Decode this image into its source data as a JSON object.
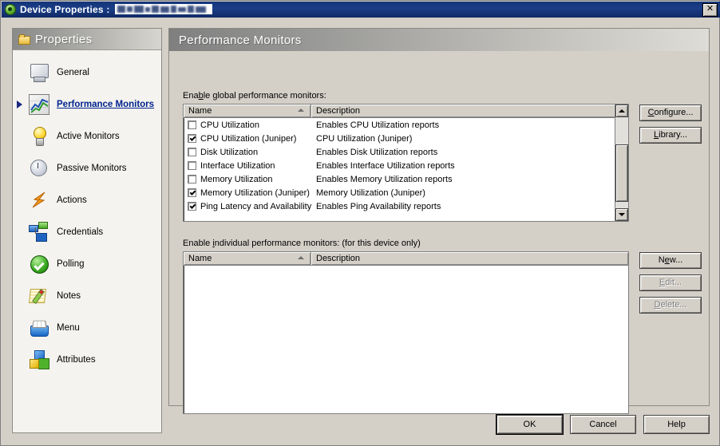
{
  "window": {
    "title": "Device Properties :",
    "device_name_redacted": true,
    "close_label": "✕",
    "icon": "green-device-icon"
  },
  "sidebar": {
    "header": "Properties",
    "header_icon": "folder-icon",
    "items": [
      {
        "label": "General",
        "icon": "computer-icon",
        "selected": false
      },
      {
        "label": "Performance Monitors",
        "icon": "chart-icon",
        "selected": true
      },
      {
        "label": "Active Monitors",
        "icon": "lightbulb-icon",
        "selected": false
      },
      {
        "label": "Passive Monitors",
        "icon": "clock-icon",
        "selected": false
      },
      {
        "label": "Actions",
        "icon": "lightning-arrow-icon",
        "selected": false
      },
      {
        "label": "Credentials",
        "icon": "network-nodes-icon",
        "selected": false
      },
      {
        "label": "Polling",
        "icon": "green-check-icon",
        "selected": false
      },
      {
        "label": "Notes",
        "icon": "notepad-pencil-icon",
        "selected": false
      },
      {
        "label": "Menu",
        "icon": "card-file-icon",
        "selected": false
      },
      {
        "label": "Attributes",
        "icon": "colored-blocks-icon",
        "selected": false
      }
    ]
  },
  "main": {
    "title": "Performance Monitors",
    "global_section": {
      "label_pre": "Ena",
      "label_key": "b",
      "label_post": "le global performance monitors:",
      "columns": [
        "Name",
        "Description"
      ],
      "sort_column": "Name",
      "sort_direction": "ascending",
      "rows": [
        {
          "checked": false,
          "name": "CPU Utilization",
          "description": "Enables CPU Utilization reports"
        },
        {
          "checked": true,
          "name": "CPU Utilization (Juniper)",
          "description": "CPU Utilization (Juniper)"
        },
        {
          "checked": false,
          "name": "Disk Utilization",
          "description": "Enables Disk Utilization reports"
        },
        {
          "checked": false,
          "name": "Interface Utilization",
          "description": "Enables Interface Utilization reports"
        },
        {
          "checked": false,
          "name": "Memory Utilization",
          "description": "Enables Memory Utilization reports"
        },
        {
          "checked": true,
          "name": "Memory Utilization (Juniper)",
          "description": "Memory Utilization (Juniper)"
        },
        {
          "checked": true,
          "name": "Ping Latency and Availability",
          "description": "Enables Ping Availability reports"
        }
      ],
      "buttons": [
        {
          "label_pre": "",
          "label_key": "C",
          "label_post": "onfigure...",
          "enabled": true
        },
        {
          "label_pre": "",
          "label_key": "L",
          "label_post": "ibrary...",
          "enabled": true
        }
      ]
    },
    "individual_section": {
      "label_pre": "Enable ",
      "label_key": "i",
      "label_post": "ndividual performance monitors: (for this device only)",
      "columns": [
        "Name",
        "Description"
      ],
      "sort_column": "Name",
      "sort_direction": "ascending",
      "rows": [],
      "buttons": [
        {
          "label_pre": "N",
          "label_key": "e",
          "label_post": "w...",
          "enabled": true
        },
        {
          "label_pre": "",
          "label_key": "E",
          "label_post": "dit...",
          "enabled": false
        },
        {
          "label_pre": "",
          "label_key": "D",
          "label_post": "elete...",
          "enabled": false
        }
      ]
    }
  },
  "footer": {
    "ok": "OK",
    "cancel": "Cancel",
    "help": "Help"
  }
}
